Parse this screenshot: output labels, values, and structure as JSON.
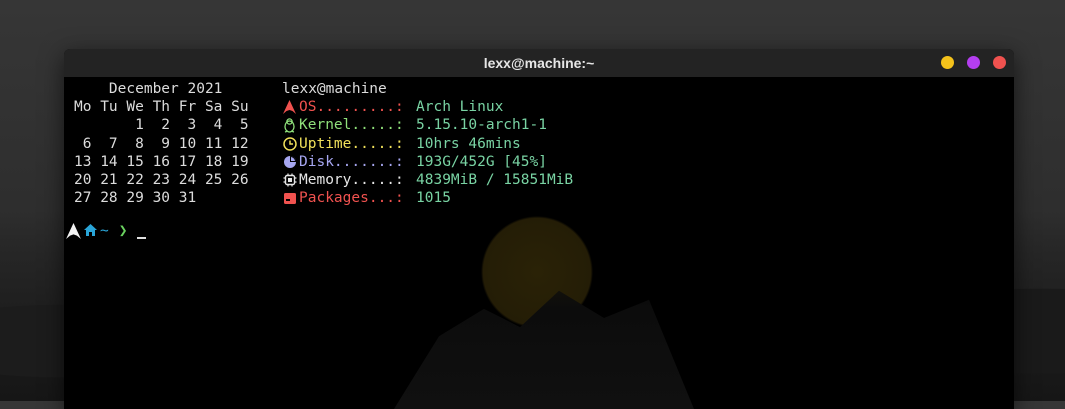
{
  "window": {
    "title": "lexx@machine:~",
    "buttons": [
      {
        "name": "minimize",
        "color": "#f4c21b"
      },
      {
        "name": "maximize",
        "color": "#b43ef0"
      },
      {
        "name": "close",
        "color": "#f0524f"
      }
    ]
  },
  "calendar": {
    "text": "    December 2021\nMo Tu We Th Fr Sa Su\n       1  2  3  4  5\n 6  7  8  9 10 11 12\n13 14 15 16 17 18 19\n20 21 22 23 24 25 26\n27 28 29 30 31"
  },
  "sysinfo": {
    "title": "lexx@machine",
    "rows": [
      {
        "icon": "arch-logo-icon",
        "label": "OS.........:",
        "value": "Arch Linux",
        "color": "#f0524f"
      },
      {
        "icon": "tux-penguin-icon",
        "label": "Kernel.....:",
        "value": "5.15.10-arch1-1",
        "color": "#8fe07a"
      },
      {
        "icon": "clock-icon",
        "label": "Uptime.....:",
        "value": "10hrs 46mins",
        "color": "#f0e05a"
      },
      {
        "icon": "pie-chart-icon",
        "label": "Disk.......:",
        "value": "193G/452G [45%]",
        "color": "#a6a6f0"
      },
      {
        "icon": "memory-chip-icon",
        "label": "Memory.....:",
        "value": "4839MiB / 15851MiB",
        "color": "#e6e6e6"
      },
      {
        "icon": "package-icon",
        "label": "Packages...:",
        "value": "1015",
        "color": "#f0524f"
      }
    ]
  },
  "prompt": {
    "path": "~",
    "arrow": "❯"
  }
}
